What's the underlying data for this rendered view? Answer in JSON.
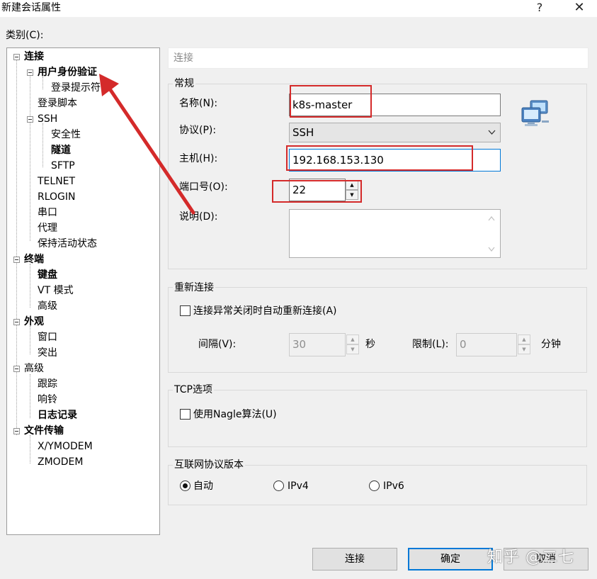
{
  "window": {
    "title": "新建会话属性",
    "help_glyph": "?",
    "close_glyph": "✕"
  },
  "category_label": "类别(C):",
  "tree": [
    {
      "label": "连接",
      "bold": true
    },
    {
      "label": "用户身份验证",
      "bold": true
    },
    {
      "label": "登录提示符",
      "bold": false
    },
    {
      "label": "登录脚本",
      "bold": false
    },
    {
      "label": "SSH",
      "bold": false
    },
    {
      "label": "安全性",
      "bold": false
    },
    {
      "label": "隧道",
      "bold": true
    },
    {
      "label": "SFTP",
      "bold": false
    },
    {
      "label": "TELNET",
      "bold": false
    },
    {
      "label": "RLOGIN",
      "bold": false
    },
    {
      "label": "串口",
      "bold": false
    },
    {
      "label": "代理",
      "bold": false
    },
    {
      "label": "保持活动状态",
      "bold": false
    },
    {
      "label": "终端",
      "bold": true
    },
    {
      "label": "键盘",
      "bold": true
    },
    {
      "label": "VT 模式",
      "bold": false
    },
    {
      "label": "高级",
      "bold": false
    },
    {
      "label": "外观",
      "bold": true
    },
    {
      "label": "窗口",
      "bold": false
    },
    {
      "label": "突出",
      "bold": false
    },
    {
      "label": "高级",
      "bold": false
    },
    {
      "label": "跟踪",
      "bold": false
    },
    {
      "label": "响铃",
      "bold": false
    },
    {
      "label": "日志记录",
      "bold": true
    },
    {
      "label": "文件传输",
      "bold": true
    },
    {
      "label": "X/YMODEM",
      "bold": false
    },
    {
      "label": "ZMODEM",
      "bold": false
    }
  ],
  "header": {
    "title": "连接"
  },
  "general": {
    "group_title": "常规",
    "name_label": "名称(N):",
    "name_value": "k8s-master",
    "protocol_label": "协议(P):",
    "protocol_value": "SSH",
    "host_label": "主机(H):",
    "host_value": "192.168.153.130",
    "port_label": "端口号(O):",
    "port_value": "22",
    "desc_label": "说明(D):",
    "desc_value": ""
  },
  "reconnect": {
    "group_title": "重新连接",
    "checkbox_label": "连接异常关闭时自动重新连接(A)",
    "checked": false,
    "interval_label": "间隔(V):",
    "interval_value": "30",
    "interval_unit": "秒",
    "limit_label": "限制(L):",
    "limit_value": "0",
    "limit_unit": "分钟"
  },
  "tcp": {
    "group_title": "TCP选项",
    "nagle_label": "使用Nagle算法(U)",
    "checked": false
  },
  "ip_version": {
    "group_title": "互联网协议版本",
    "options": [
      {
        "label": "自动",
        "checked": true
      },
      {
        "label": "IPv4",
        "checked": false
      },
      {
        "label": "IPv6",
        "checked": false
      }
    ]
  },
  "buttons": {
    "connect": "连接",
    "ok": "确定",
    "cancel": "取消"
  },
  "watermark": "知乎 @二七",
  "colors": {
    "annotation_red": "#d42a2a",
    "focus_blue": "#0078d7"
  }
}
